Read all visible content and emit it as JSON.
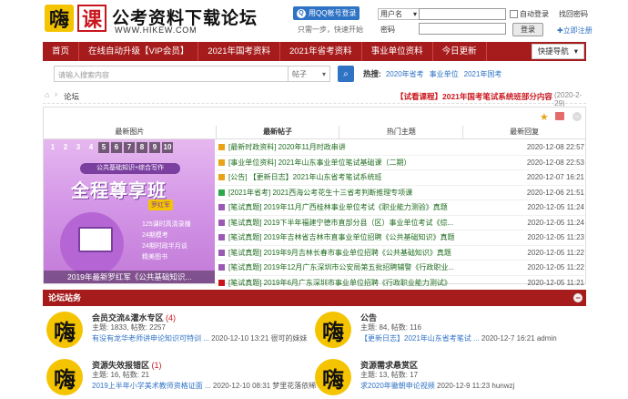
{
  "header": {
    "logo_char1": "嗨",
    "logo_char2": "课",
    "site_title": "公考资料下载论坛",
    "site_url": "WWW.HIKEW.COM",
    "qq_login_label": "用QQ帐号登录",
    "qq_icon": "qq-icon",
    "tagline": "只需一步，快速开始",
    "username_select": "用户名",
    "username_value": "",
    "auto_login_label": "自动登录",
    "forgot_password": "找回密码",
    "password_label": "密码",
    "password_value": "",
    "login_button": "登录",
    "register_link": "立即注册"
  },
  "nav": {
    "items": [
      "首页",
      "在线自动升级【VIP会员】",
      "2021年国考资料",
      "2021年省考资料",
      "事业单位资料",
      "今日更新"
    ],
    "quick_nav": "快捷导航"
  },
  "search": {
    "placeholder": "请输入搜索内容",
    "scope": "帖子",
    "hot_label": "热搜:",
    "hot_items": [
      "2020年省考",
      "事业单位",
      "2021年国考"
    ]
  },
  "breadcrumb": {
    "home_icon": "home-icon",
    "current": "论坛",
    "notice": "【试看课程】2021年国考笔试系统班部分内容",
    "notice_date": "(2020-2-29)"
  },
  "panel": {
    "tabs": [
      "最新图片",
      "最新帖子",
      "热门主题",
      "最新回复"
    ],
    "promo": {
      "pager": [
        "1",
        "2",
        "3",
        "4",
        "5",
        "6",
        "7",
        "8",
        "9",
        "10"
      ],
      "subtitle": "公共基础知识+综合写作",
      "headline": "全程尊享班",
      "teacher": "罗红军",
      "feature1": "125课时高清录播",
      "feature2": "24期模考",
      "feature3": "24期时政半月谈",
      "feature4": "精美图书",
      "caption": "2019年最新罗红军《公共基础知识..."
    },
    "posts": [
      {
        "title": "[最新时政资料] 2020年11月时政串讲",
        "date": "2020-12-08 22:57",
        "color": "#e8a317"
      },
      {
        "title": "[事业单位资料] 2021年山东事业单位笔试基础课（二期）",
        "date": "2020-12-08 22:53",
        "color": "#e8a317"
      },
      {
        "title": "[公告] 【更新日志】2021年山东省考笔试系统班",
        "date": "2020-12-07 16:21",
        "color": "#e8a317"
      },
      {
        "title": "[2021年省考] 2021西海公考花生十三省考判断推理专项课",
        "date": "2020-12-06 21:51",
        "color": "#2ba84a"
      },
      {
        "title": "[笔试真题] 2019年11月广西桂林事业单位考试《职业能力测验》真题",
        "date": "2020-12-05 11:24",
        "color": "#9b59b6"
      },
      {
        "title": "[笔试真题] 2019下半年福建宁德市直部分县（区）事业单位考试《综...",
        "date": "2020-12-05 11:24",
        "color": "#9b59b6"
      },
      {
        "title": "[笔试真题] 2019年吉林省吉林市直事业单位招聘《公共基础知识》真题",
        "date": "2020-12-05 11:23",
        "color": "#9b59b6"
      },
      {
        "title": "[笔试真题] 2019年9月吉林长春市事业单位招聘《公共基础知识》真题",
        "date": "2020-12-05 11:22",
        "color": "#9b59b6"
      },
      {
        "title": "[笔试真题] 2019年12月广东深圳市公安局第五批招聘辅警《行政职业...",
        "date": "2020-12-05 11:22",
        "color": "#9b59b6"
      },
      {
        "title": "[笔试真题] 2019年6月广东深圳市事业单位招聘《行政职业能力测试》",
        "date": "2020-12-05 11:21",
        "color": "#c9161d"
      }
    ]
  },
  "forum": {
    "heading": "论坛站务",
    "icon_char": "嗨",
    "forums": [
      {
        "name": "会员交流&灌水专区",
        "count": "(4)",
        "stats": "主题: 1833, 帖数: 2257",
        "last_title": "有没有龙华老师讲申论知识可特训 ...",
        "last_info": "2020-12-10 13:21 很可的妹妹"
      },
      {
        "name": "公告",
        "count": "",
        "stats": "主题: 84, 帖数: 116",
        "last_title": "【更新日志】2021年山东省考笔试 ...",
        "last_info": "2020-12-7 16:21 admin"
      },
      {
        "name": "资源失效报错区",
        "count": "(1)",
        "stats": "主题: 16, 帖数: 21",
        "last_title": "2019上半年小学美术教师资格证面 ...",
        "last_info": "2020-12-10 08:31 梦里花落依稀"
      },
      {
        "name": "资源需求悬赏区",
        "count": "",
        "stats": "主题: 13, 帖数: 17",
        "last_title": "求2020年徽朝申论视频",
        "last_info": "2020-12-9 11:23 hunwzj"
      }
    ]
  },
  "colors": {
    "brand_red": "#a61c1c",
    "accent_blue": "#2f73c5",
    "logo_yellow": "#f5c400"
  }
}
